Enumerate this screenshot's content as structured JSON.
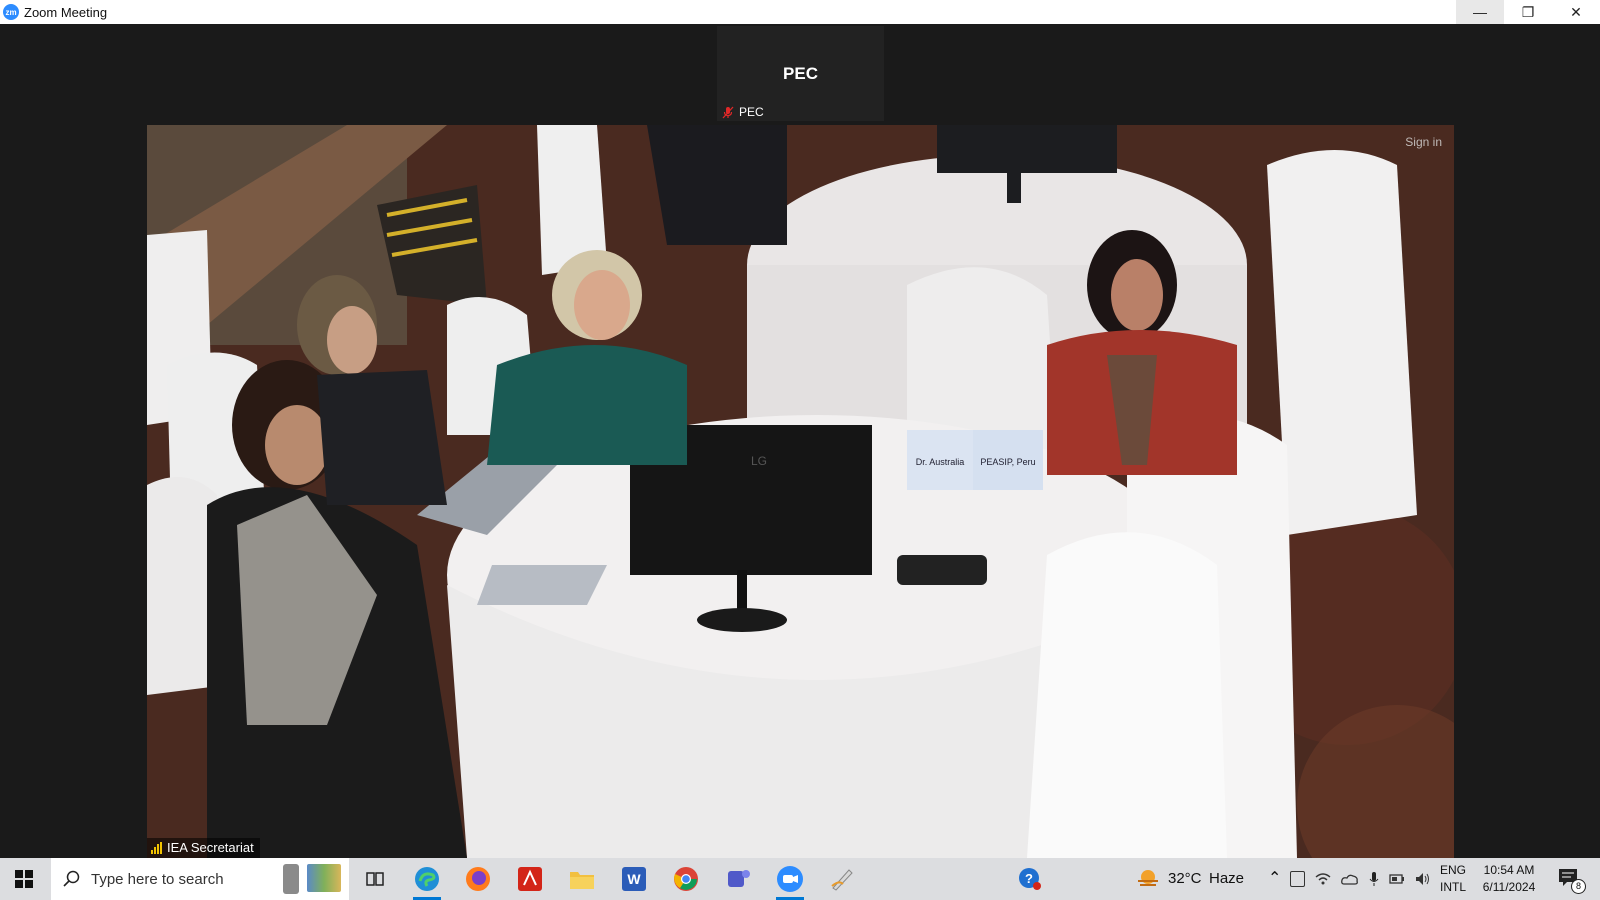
{
  "window": {
    "title": "Zoom Meeting",
    "app_icon_text": "zm",
    "controls": {
      "minimize": "—",
      "restore": "❐",
      "close": "✕"
    }
  },
  "thumbnail": {
    "name": "PEC",
    "label": "PEC",
    "muted": true
  },
  "video": {
    "participant_label": "IEA Secretariat",
    "overlay_text": "Sign in",
    "placard_left": "Dr. Australia",
    "placard_right": "PEASIP, Peru",
    "monitor_brand": "LG"
  },
  "taskbar": {
    "search_placeholder": "Type here to search",
    "apps": [
      "task-view",
      "edge",
      "firefox",
      "acrobat",
      "file-explorer",
      "word",
      "chrome",
      "teams",
      "zoom",
      "pen-app"
    ],
    "active_apps": [
      "edge",
      "zoom"
    ],
    "weather": {
      "temp": "32°C",
      "condition": "Haze"
    },
    "language": {
      "line1": "ENG",
      "line2": "INTL"
    },
    "time": "10:54 AM",
    "date": "6/11/2024",
    "notification_count": "8"
  },
  "colors": {
    "accent": "#2d8cff",
    "taskbar": "#dcdde0",
    "active": "#0078d4"
  }
}
